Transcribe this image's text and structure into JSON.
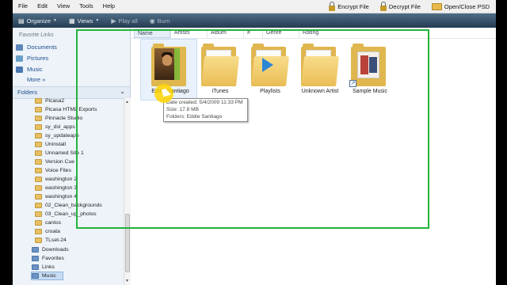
{
  "menu": [
    "File",
    "Edit",
    "View",
    "Tools",
    "Help"
  ],
  "top_tools": {
    "encrypt": "Encrypt File",
    "decrypt": "Decrypt File",
    "open_close": "Open/Close PSD"
  },
  "toolbar": {
    "organize": "Organize",
    "views": "Views",
    "play_all": "Play all",
    "burn": "Burn"
  },
  "nav": {
    "favorite_links_title": "Favorite Links",
    "favorites": [
      "Documents",
      "Pictures",
      "Music"
    ],
    "more": "More",
    "folders_title": "Folders",
    "tree": [
      "Picasa2",
      "Picasa HTML Exports",
      "Pinnacle Studio",
      "sy_dsl_apps",
      "sy_updateapp",
      "Uninstall",
      "Unnamed Site 1",
      "Version Cue",
      "Voice Files",
      "washington 2",
      "washington 3",
      "washington 4",
      "02_Clean_backgrounds",
      "03_Clean_up_photos",
      "cantos",
      "croata",
      "TLset-24",
      "Downloads",
      "Favorites",
      "Links",
      "Music"
    ]
  },
  "columns": [
    "Name",
    "Artists",
    "Album",
    "#",
    "Genre",
    "Rating"
  ],
  "items": [
    {
      "label": "Eddie Santiago",
      "icon": "folder-photo-icon"
    },
    {
      "label": "iTunes",
      "icon": "folder-icon"
    },
    {
      "label": "Playlists",
      "icon": "folder-playlist-icon"
    },
    {
      "label": "Unknown Artist",
      "icon": "folder-icon"
    },
    {
      "label": "Sample Music",
      "icon": "folder-shortcut-icon"
    }
  ],
  "tooltip": {
    "created": "Date created: 5/4/2009 11:33 PM",
    "size": "Size: 17.8 MB",
    "folders": "Folders: Eddie Santiago"
  },
  "colors": {
    "highlight_frame": "#23b33b",
    "cursor_highlight": "#ffd600",
    "toolbar": "#2c465d"
  }
}
